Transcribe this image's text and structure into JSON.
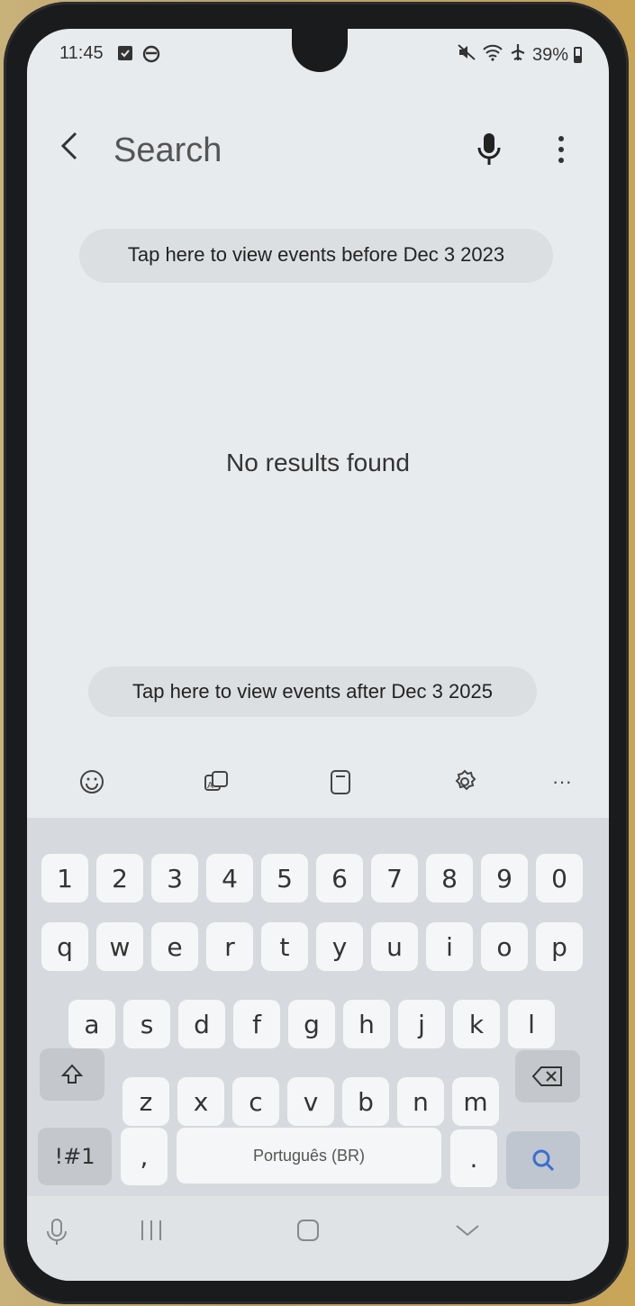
{
  "status": {
    "time": "11:45",
    "battery": "39%"
  },
  "header": {
    "title": "Search",
    "back_icon": "back-chevron-icon",
    "mic_icon": "microphone-icon",
    "more_icon": "more-vertical-icon"
  },
  "results": {
    "before_label": "Tap here to view events before Dec 3 2023",
    "empty_label": "No results found",
    "after_label": "Tap here to view events after Dec 3 2025"
  },
  "keyboard": {
    "toolbar": [
      "emoji-icon",
      "translate-icon",
      "clipboard-icon",
      "settings-icon",
      "more-horizontal-icon"
    ],
    "toolbar_more": "···",
    "row_numbers": [
      "1",
      "2",
      "3",
      "4",
      "5",
      "6",
      "7",
      "8",
      "9",
      "0"
    ],
    "row1": [
      "q",
      "w",
      "e",
      "r",
      "t",
      "y",
      "u",
      "i",
      "o",
      "p"
    ],
    "row2": [
      "a",
      "s",
      "d",
      "f",
      "g",
      "h",
      "j",
      "k",
      "l"
    ],
    "row3": [
      "z",
      "x",
      "c",
      "v",
      "b",
      "n",
      "m"
    ],
    "symbols_label": "!#1",
    "comma_label": ",",
    "space_label": "Português (BR)",
    "period_label": "."
  },
  "nav": {
    "items": [
      "voice-input-icon",
      "recents-icon",
      "home-icon",
      "hide-keyboard-icon"
    ]
  },
  "colors": {
    "accent": "#3a6fd0",
    "background": "#e8ebee"
  }
}
